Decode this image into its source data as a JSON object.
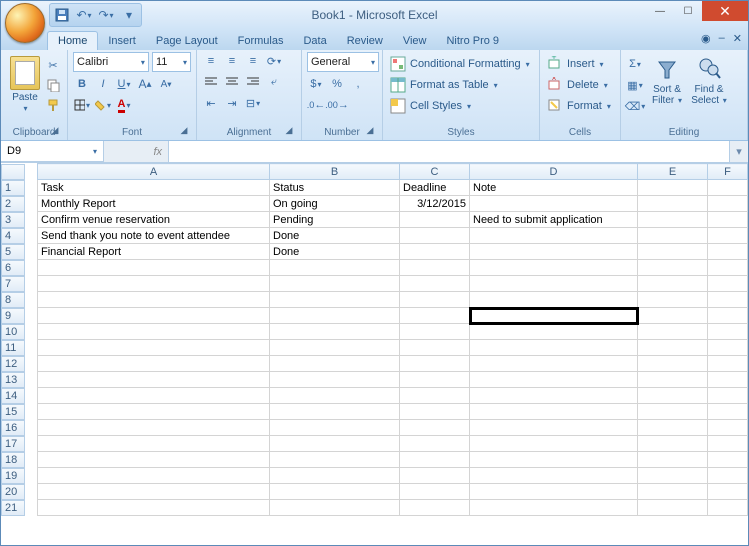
{
  "titlebar": {
    "title": "Book1 - Microsoft Excel"
  },
  "tabs": [
    "Home",
    "Insert",
    "Page Layout",
    "Formulas",
    "Data",
    "Review",
    "View",
    "Nitro Pro 9"
  ],
  "active_tab": "Home",
  "groups": {
    "clipboard": {
      "label": "Clipboard",
      "paste": "Paste"
    },
    "font": {
      "label": "Font",
      "name": "Calibri",
      "size": "11"
    },
    "alignment": {
      "label": "Alignment"
    },
    "number": {
      "label": "Number",
      "format": "General"
    },
    "styles": {
      "label": "Styles",
      "conditional": "Conditional Formatting",
      "as_table": "Format as Table",
      "cell_styles": "Cell Styles"
    },
    "cells": {
      "label": "Cells",
      "insert": "Insert",
      "delete": "Delete",
      "format": "Format"
    },
    "editing": {
      "label": "Editing",
      "sort": "Sort & Filter",
      "find": "Find & Select"
    }
  },
  "namebox": "D9",
  "formula": "",
  "columns": [
    "A",
    "B",
    "C",
    "D",
    "E",
    "F"
  ],
  "rows": [
    "1",
    "2",
    "3",
    "4",
    "5",
    "6",
    "7",
    "8",
    "9",
    "10",
    "11",
    "12",
    "13",
    "14",
    "15",
    "16",
    "17",
    "18",
    "19",
    "20",
    "21"
  ],
  "cells": {
    "A1": "Task",
    "B1": "Status",
    "C1": "Deadline",
    "D1": "Note",
    "A2": "Monthly Report",
    "B2": "On going",
    "C2": "3/12/2015",
    "A3": "Confirm venue reservation",
    "B3": "Pending",
    "D3": "Need to submit application",
    "A4": "Send thank you note to event attendee",
    "B4": "Done",
    "A5": "Financial Report",
    "B5": "Done"
  },
  "selected_cell": "D9"
}
